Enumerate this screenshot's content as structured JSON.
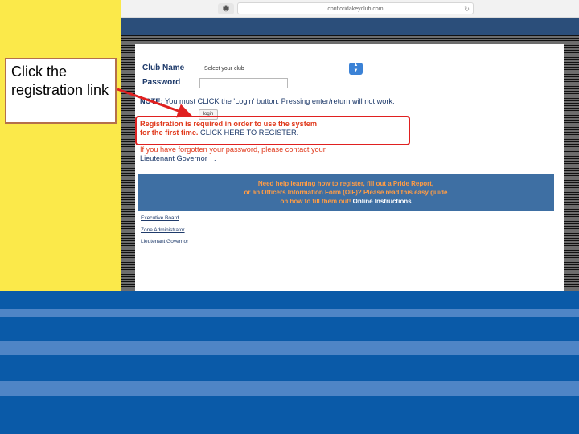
{
  "browser": {
    "url": "cpnfloridakeyclub.com"
  },
  "callout": {
    "text": "Click the registration link"
  },
  "form": {
    "club_label": "Club Name",
    "club_select_value": "Select your club",
    "password_label": "Password",
    "note_bold": "NOTE:",
    "note_text": " You must CLICK the 'Login' button. Pressing enter/return will not work.",
    "login_button": "login"
  },
  "registration": {
    "line1": "Registration is required in order to use the system",
    "line2_bold": "for the first time.",
    "line2_link": " CLICK HERE TO REGISTER."
  },
  "forgot": {
    "text": "If you have forgotten your password, please contact your",
    "link": "Lieutenant Governor",
    "period": "."
  },
  "help": {
    "line1": "Need help learning how to register, fill out a Pride Report,",
    "line2": "or an Officers Information Form (OIF)? Please read this easy guide",
    "line3": "on how to fill them out!",
    "line3_link": " Online Instructions"
  },
  "links": {
    "executive_board": "Executive Board",
    "zone_administrator": "Zone Administrator",
    "lieutenant_governor": "Lieutenant Governor"
  },
  "colors": {
    "yellow": "#fbe94a",
    "navy_header": "#2b4e7a",
    "blue_band": "#0a5aa8",
    "light_stripe": "#4f85c6",
    "help_box": "#3e6fa3",
    "accent_red": "#e02020",
    "accent_orange": "#e03b1e",
    "text_navy": "#1f3b6b"
  },
  "icons": {
    "tab": "shield-icon",
    "reload": "reload-icon",
    "select": "updown-chevron-icon"
  }
}
